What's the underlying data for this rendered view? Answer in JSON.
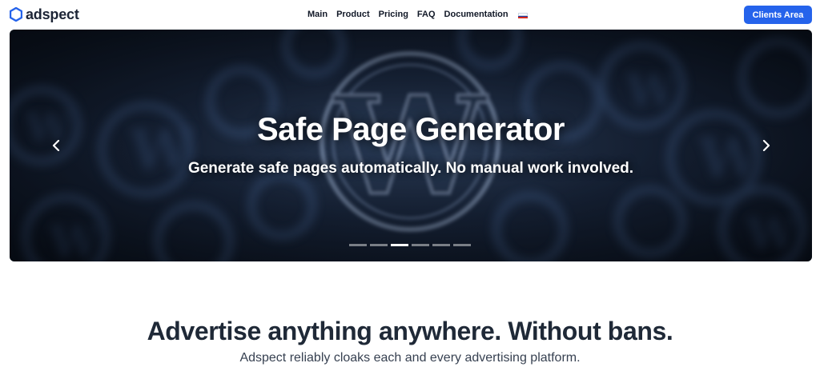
{
  "brand": {
    "name": "adspect",
    "color": "#2563eb"
  },
  "nav": {
    "items": [
      "Main",
      "Product",
      "Pricing",
      "FAQ",
      "Documentation"
    ],
    "language_flag": "russian-flag-icon",
    "flag_colors": [
      "#ffffff",
      "#1c3fa8",
      "#d52b1e"
    ]
  },
  "header": {
    "clients_button": "Clients Area"
  },
  "carousel": {
    "slide_title": "Safe Page Generator",
    "slide_subtitle": "Generate safe pages automatically. No manual work involved.",
    "background_icon": "wordpress-logo-icon",
    "prev_icon": "chevron-left-icon",
    "next_icon": "chevron-right-icon",
    "slide_count": 6,
    "active_index": 2
  },
  "hero": {
    "title": "Advertise anything anywhere. Without bans.",
    "subtitle": "Adspect reliably cloaks each and every advertising platform."
  }
}
